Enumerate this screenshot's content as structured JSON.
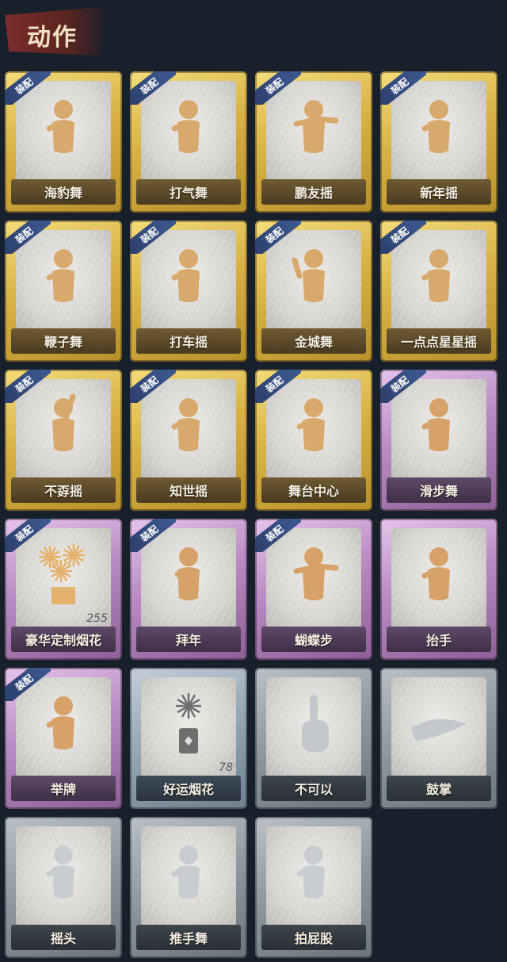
{
  "header": {
    "title": "动作"
  },
  "equip_label": "装配",
  "cards": [
    {
      "name": "海豹舞",
      "rarity": "gold",
      "equipped": true,
      "icon": "dancer-figure-icon"
    },
    {
      "name": "打气舞",
      "rarity": "gold",
      "equipped": true,
      "icon": "dancer-figure-icon"
    },
    {
      "name": "鹏友摇",
      "rarity": "gold",
      "equipped": true,
      "icon": "pointing-figure-icon"
    },
    {
      "name": "新年摇",
      "rarity": "gold",
      "equipped": true,
      "icon": "dancer-figure-icon"
    },
    {
      "name": "鞭子舞",
      "rarity": "gold",
      "equipped": true,
      "icon": "dancer-figure-icon"
    },
    {
      "name": "打车摇",
      "rarity": "gold",
      "equipped": true,
      "icon": "dancer-figure-icon"
    },
    {
      "name": "金城舞",
      "rarity": "gold",
      "equipped": true,
      "icon": "waving-figure-icon"
    },
    {
      "name": "一点点星星摇",
      "rarity": "gold",
      "equipped": true,
      "icon": "dancer-figure-icon"
    },
    {
      "name": "不孬摇",
      "rarity": "gold",
      "equipped": true,
      "icon": "arm-raised-figure-icon"
    },
    {
      "name": "知世摇",
      "rarity": "gold",
      "equipped": true,
      "icon": "dancer-figure-icon"
    },
    {
      "name": "舞台中心",
      "rarity": "gold",
      "equipped": true,
      "icon": "dancer-figure-icon"
    },
    {
      "name": "滑步舞",
      "rarity": "purple",
      "equipped": true,
      "icon": "dancer-figure-icon"
    },
    {
      "name": "豪华定制烟花",
      "rarity": "purple",
      "equipped": true,
      "icon": "fireworks-box-icon",
      "count": "255"
    },
    {
      "name": "拜年",
      "rarity": "purple",
      "equipped": true,
      "icon": "bowing-figure-icon"
    },
    {
      "name": "蝴蝶步",
      "rarity": "purple",
      "equipped": true,
      "icon": "pointing-figure-icon"
    },
    {
      "name": "抬手",
      "rarity": "purple",
      "equipped": false,
      "icon": "raise-hand-figure-icon"
    },
    {
      "name": "举牌",
      "rarity": "purple",
      "equipped": true,
      "icon": "sign-holding-figure-icon"
    },
    {
      "name": "好运烟花",
      "rarity": "blue",
      "equipped": false,
      "icon": "firework-cracker-icon",
      "count": "78"
    },
    {
      "name": "不可以",
      "rarity": "grey",
      "equipped": false,
      "icon": "finger-wag-icon"
    },
    {
      "name": "鼓掌",
      "rarity": "grey",
      "equipped": false,
      "icon": "clapping-hands-icon"
    },
    {
      "name": "摇头",
      "rarity": "grey",
      "equipped": false,
      "icon": "head-shake-figure-icon"
    },
    {
      "name": "推手舞",
      "rarity": "grey",
      "equipped": false,
      "icon": "push-hand-figure-icon"
    },
    {
      "name": "拍屁股",
      "rarity": "grey",
      "equipped": false,
      "icon": "butt-slap-figure-icon"
    }
  ]
}
